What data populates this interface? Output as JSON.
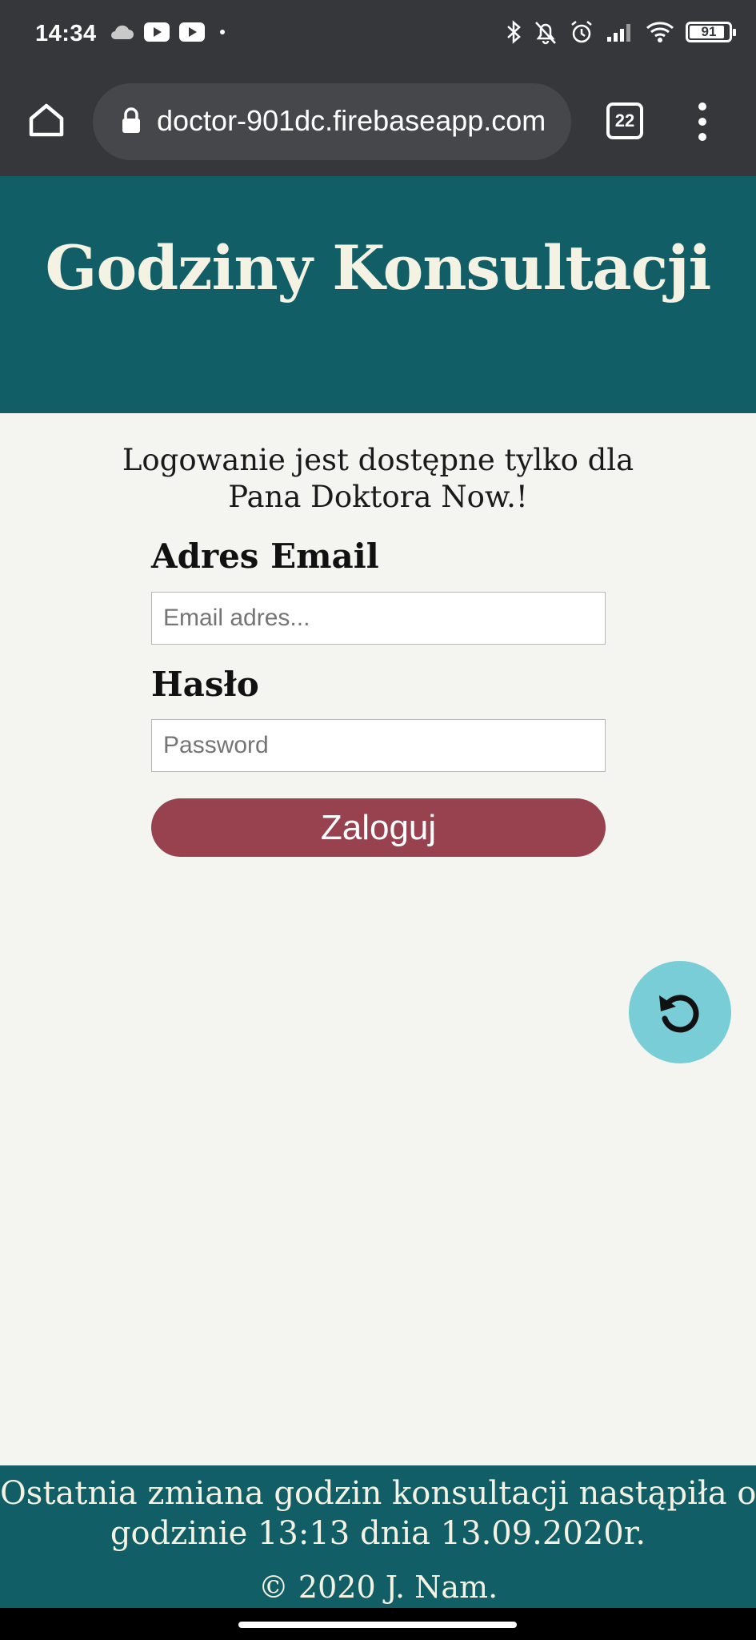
{
  "status_bar": {
    "time": "14:34",
    "left_icons": [
      "cloud-icon",
      "youtube-icon",
      "youtube-icon",
      "dot-icon"
    ],
    "right_icons": [
      "bluetooth-icon",
      "bell-off-icon",
      "alarm-icon",
      "signal-icon",
      "wifi-icon"
    ],
    "battery": "91",
    "battery_level": 0.91
  },
  "browser": {
    "url": "doctor-901dc.firebaseapp.com",
    "tab_count": "22"
  },
  "header": {
    "title": "Godziny Konsultacji"
  },
  "login": {
    "intro": "Logowanie jest dostępne tylko dla Pana Doktora Now.!",
    "email_label": "Adres Email",
    "email_placeholder": "Email adres...",
    "password_label": "Hasło",
    "password_placeholder": "Password",
    "submit_label": "Zaloguj"
  },
  "fab": {
    "icon": "refresh-icon"
  },
  "footer": {
    "note_line1": "Ostatnia zmiana godzin konsultacji nastąpiła o",
    "note_line2": "godzinie 13:13 dnia 13.09.2020r.",
    "copyright": "© 2020 J. Nam."
  },
  "colors": {
    "header_bg": "#115e66",
    "button_bg": "#98424f",
    "fab_bg": "#78cdd7",
    "page_bg": "#f4f4f0"
  }
}
